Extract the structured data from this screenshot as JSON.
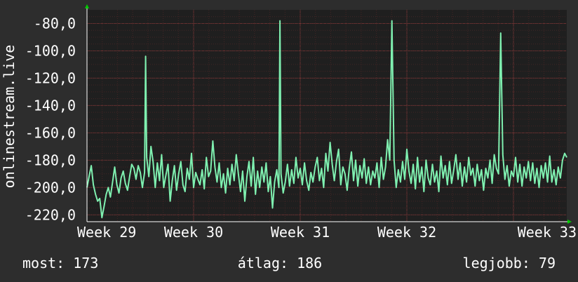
{
  "chart_data": {
    "type": "line",
    "title": "",
    "ylabel": "onlinestream.live",
    "xlabel": "",
    "ylim": [
      -225,
      -70
    ],
    "xlim": [
      0,
      4.5
    ],
    "y_ticks": [
      -220,
      -200,
      -180,
      -160,
      -140,
      -120,
      -100,
      -80
    ],
    "y_tick_labels": [
      "-220,0",
      "-200,0",
      "-180,0",
      "-160,0",
      "-140,0",
      "-120,0",
      "-100,0",
      "-80,0"
    ],
    "x_ticks": [
      0,
      1,
      2,
      3,
      4
    ],
    "x_tick_labels": [
      "Week 29",
      "Week 30",
      "Week 31",
      "Week 32",
      "Week 33"
    ],
    "grid": true,
    "colors": {
      "background": "#2d2d2d",
      "plot_bg": "#1f1f1f",
      "grid": "#5a2a2a",
      "line": "#7ff0b0",
      "arrow": "#00cc00",
      "text": "#ffffff"
    },
    "series": [
      {
        "values": [
          [
            0.0,
            -200
          ],
          [
            0.02,
            -192
          ],
          [
            0.04,
            -184
          ],
          [
            0.06,
            -198
          ],
          [
            0.08,
            -205
          ],
          [
            0.1,
            -210
          ],
          [
            0.12,
            -208
          ],
          [
            0.14,
            -222
          ],
          [
            0.16,
            -214
          ],
          [
            0.18,
            -205
          ],
          [
            0.2,
            -200
          ],
          [
            0.22,
            -207
          ],
          [
            0.24,
            -196
          ],
          [
            0.26,
            -185
          ],
          [
            0.28,
            -198
          ],
          [
            0.3,
            -204
          ],
          [
            0.32,
            -193
          ],
          [
            0.34,
            -188
          ],
          [
            0.36,
            -197
          ],
          [
            0.38,
            -202
          ],
          [
            0.4,
            -192
          ],
          [
            0.42,
            -183
          ],
          [
            0.44,
            -186
          ],
          [
            0.46,
            -194
          ],
          [
            0.48,
            -184
          ],
          [
            0.5,
            -189
          ],
          [
            0.52,
            -200
          ],
          [
            0.54,
            -189
          ],
          [
            0.55,
            -104
          ],
          [
            0.56,
            -178
          ],
          [
            0.58,
            -192
          ],
          [
            0.6,
            -170
          ],
          [
            0.62,
            -181
          ],
          [
            0.64,
            -200
          ],
          [
            0.66,
            -182
          ],
          [
            0.68,
            -195
          ],
          [
            0.7,
            -176
          ],
          [
            0.72,
            -200
          ],
          [
            0.74,
            -191
          ],
          [
            0.76,
            -183
          ],
          [
            0.78,
            -210
          ],
          [
            0.8,
            -195
          ],
          [
            0.82,
            -184
          ],
          [
            0.84,
            -202
          ],
          [
            0.86,
            -190
          ],
          [
            0.88,
            -181
          ],
          [
            0.9,
            -198
          ],
          [
            0.92,
            -203
          ],
          [
            0.94,
            -186
          ],
          [
            0.96,
            -194
          ],
          [
            0.98,
            -175
          ],
          [
            1.0,
            -200
          ],
          [
            1.02,
            -189
          ],
          [
            1.04,
            -194
          ],
          [
            1.06,
            -198
          ],
          [
            1.08,
            -187
          ],
          [
            1.1,
            -201
          ],
          [
            1.12,
            -178
          ],
          [
            1.14,
            -192
          ],
          [
            1.16,
            -188
          ],
          [
            1.18,
            -166
          ],
          [
            1.2,
            -185
          ],
          [
            1.22,
            -196
          ],
          [
            1.24,
            -182
          ],
          [
            1.26,
            -200
          ],
          [
            1.28,
            -190
          ],
          [
            1.3,
            -204
          ],
          [
            1.32,
            -186
          ],
          [
            1.34,
            -198
          ],
          [
            1.36,
            -183
          ],
          [
            1.38,
            -195
          ],
          [
            1.4,
            -176
          ],
          [
            1.42,
            -190
          ],
          [
            1.44,
            -203
          ],
          [
            1.46,
            -188
          ],
          [
            1.48,
            -210
          ],
          [
            1.5,
            -192
          ],
          [
            1.52,
            -181
          ],
          [
            1.54,
            -199
          ],
          [
            1.56,
            -178
          ],
          [
            1.58,
            -205
          ],
          [
            1.6,
            -188
          ],
          [
            1.62,
            -200
          ],
          [
            1.64,
            -185
          ],
          [
            1.66,
            -196
          ],
          [
            1.68,
            -182
          ],
          [
            1.7,
            -203
          ],
          [
            1.72,
            -192
          ],
          [
            1.74,
            -215
          ],
          [
            1.76,
            -196
          ],
          [
            1.78,
            -187
          ],
          [
            1.8,
            -200
          ],
          [
            1.81,
            -78
          ],
          [
            1.82,
            -190
          ],
          [
            1.84,
            -204
          ],
          [
            1.86,
            -196
          ],
          [
            1.88,
            -183
          ],
          [
            1.9,
            -199
          ],
          [
            1.92,
            -187
          ],
          [
            1.94,
            -197
          ],
          [
            1.96,
            -178
          ],
          [
            1.98,
            -193
          ],
          [
            2.0,
            -186
          ],
          [
            2.02,
            -198
          ],
          [
            2.04,
            -182
          ],
          [
            2.06,
            -195
          ],
          [
            2.08,
            -202
          ],
          [
            2.1,
            -189
          ],
          [
            2.12,
            -196
          ],
          [
            2.14,
            -185
          ],
          [
            2.16,
            -178
          ],
          [
            2.18,
            -195
          ],
          [
            2.2,
            -186
          ],
          [
            2.22,
            -200
          ],
          [
            2.24,
            -175
          ],
          [
            2.26,
            -188
          ],
          [
            2.28,
            -167
          ],
          [
            2.3,
            -183
          ],
          [
            2.32,
            -195
          ],
          [
            2.34,
            -181
          ],
          [
            2.36,
            -172
          ],
          [
            2.38,
            -198
          ],
          [
            2.4,
            -185
          ],
          [
            2.42,
            -190
          ],
          [
            2.44,
            -202
          ],
          [
            2.46,
            -186
          ],
          [
            2.48,
            -174
          ],
          [
            2.5,
            -195
          ],
          [
            2.52,
            -180
          ],
          [
            2.54,
            -199
          ],
          [
            2.56,
            -184
          ],
          [
            2.58,
            -193
          ],
          [
            2.6,
            -179
          ],
          [
            2.62,
            -197
          ],
          [
            2.64,
            -185
          ],
          [
            2.66,
            -198
          ],
          [
            2.68,
            -188
          ],
          [
            2.7,
            -193
          ],
          [
            2.72,
            -182
          ],
          [
            2.74,
            -200
          ],
          [
            2.76,
            -178
          ],
          [
            2.78,
            -194
          ],
          [
            2.8,
            -185
          ],
          [
            2.82,
            -165
          ],
          [
            2.84,
            -180
          ],
          [
            2.86,
            -78
          ],
          [
            2.88,
            -180
          ],
          [
            2.9,
            -200
          ],
          [
            2.92,
            -187
          ],
          [
            2.94,
            -196
          ],
          [
            2.96,
            -181
          ],
          [
            2.98,
            -194
          ],
          [
            3.0,
            -172
          ],
          [
            3.02,
            -188
          ],
          [
            3.04,
            -197
          ],
          [
            3.06,
            -183
          ],
          [
            3.08,
            -201
          ],
          [
            3.1,
            -178
          ],
          [
            3.12,
            -196
          ],
          [
            3.14,
            -185
          ],
          [
            3.16,
            -203
          ],
          [
            3.18,
            -180
          ],
          [
            3.2,
            -193
          ],
          [
            3.22,
            -198
          ],
          [
            3.24,
            -183
          ],
          [
            3.26,
            -196
          ],
          [
            3.28,
            -188
          ],
          [
            3.3,
            -203
          ],
          [
            3.32,
            -177
          ],
          [
            3.34,
            -193
          ],
          [
            3.36,
            -184
          ],
          [
            3.38,
            -198
          ],
          [
            3.4,
            -181
          ],
          [
            3.42,
            -197
          ],
          [
            3.44,
            -187
          ],
          [
            3.46,
            -176
          ],
          [
            3.48,
            -194
          ],
          [
            3.5,
            -182
          ],
          [
            3.52,
            -199
          ],
          [
            3.54,
            -185
          ],
          [
            3.56,
            -196
          ],
          [
            3.58,
            -178
          ],
          [
            3.6,
            -191
          ],
          [
            3.62,
            -186
          ],
          [
            3.64,
            -199
          ],
          [
            3.66,
            -183
          ],
          [
            3.68,
            -195
          ],
          [
            3.7,
            -187
          ],
          [
            3.72,
            -202
          ],
          [
            3.74,
            -186
          ],
          [
            3.76,
            -193
          ],
          [
            3.78,
            -180
          ],
          [
            3.8,
            -197
          ],
          [
            3.82,
            -176
          ],
          [
            3.84,
            -186
          ],
          [
            3.86,
            -190
          ],
          [
            3.88,
            -87
          ],
          [
            3.9,
            -176
          ],
          [
            3.92,
            -194
          ],
          [
            3.94,
            -184
          ],
          [
            3.96,
            -199
          ],
          [
            3.98,
            -188
          ],
          [
            4.0,
            -192
          ],
          [
            4.02,
            -178
          ],
          [
            4.04,
            -196
          ],
          [
            4.06,
            -183
          ],
          [
            4.08,
            -199
          ],
          [
            4.1,
            -185
          ],
          [
            4.12,
            -193
          ],
          [
            4.14,
            -181
          ],
          [
            4.16,
            -195
          ],
          [
            4.18,
            -182
          ],
          [
            4.2,
            -197
          ],
          [
            4.22,
            -186
          ],
          [
            4.24,
            -200
          ],
          [
            4.26,
            -184
          ],
          [
            4.28,
            -193
          ],
          [
            4.3,
            -182
          ],
          [
            4.32,
            -196
          ],
          [
            4.34,
            -177
          ],
          [
            4.36,
            -196
          ],
          [
            4.38,
            -187
          ],
          [
            4.4,
            -198
          ],
          [
            4.42,
            -185
          ],
          [
            4.44,
            -193
          ],
          [
            4.46,
            -180
          ],
          [
            4.48,
            -175
          ],
          [
            4.5,
            -178
          ]
        ]
      }
    ]
  },
  "stats": {
    "current": "most: 173",
    "average": "átlag: 186",
    "best": "legjobb: 79"
  }
}
